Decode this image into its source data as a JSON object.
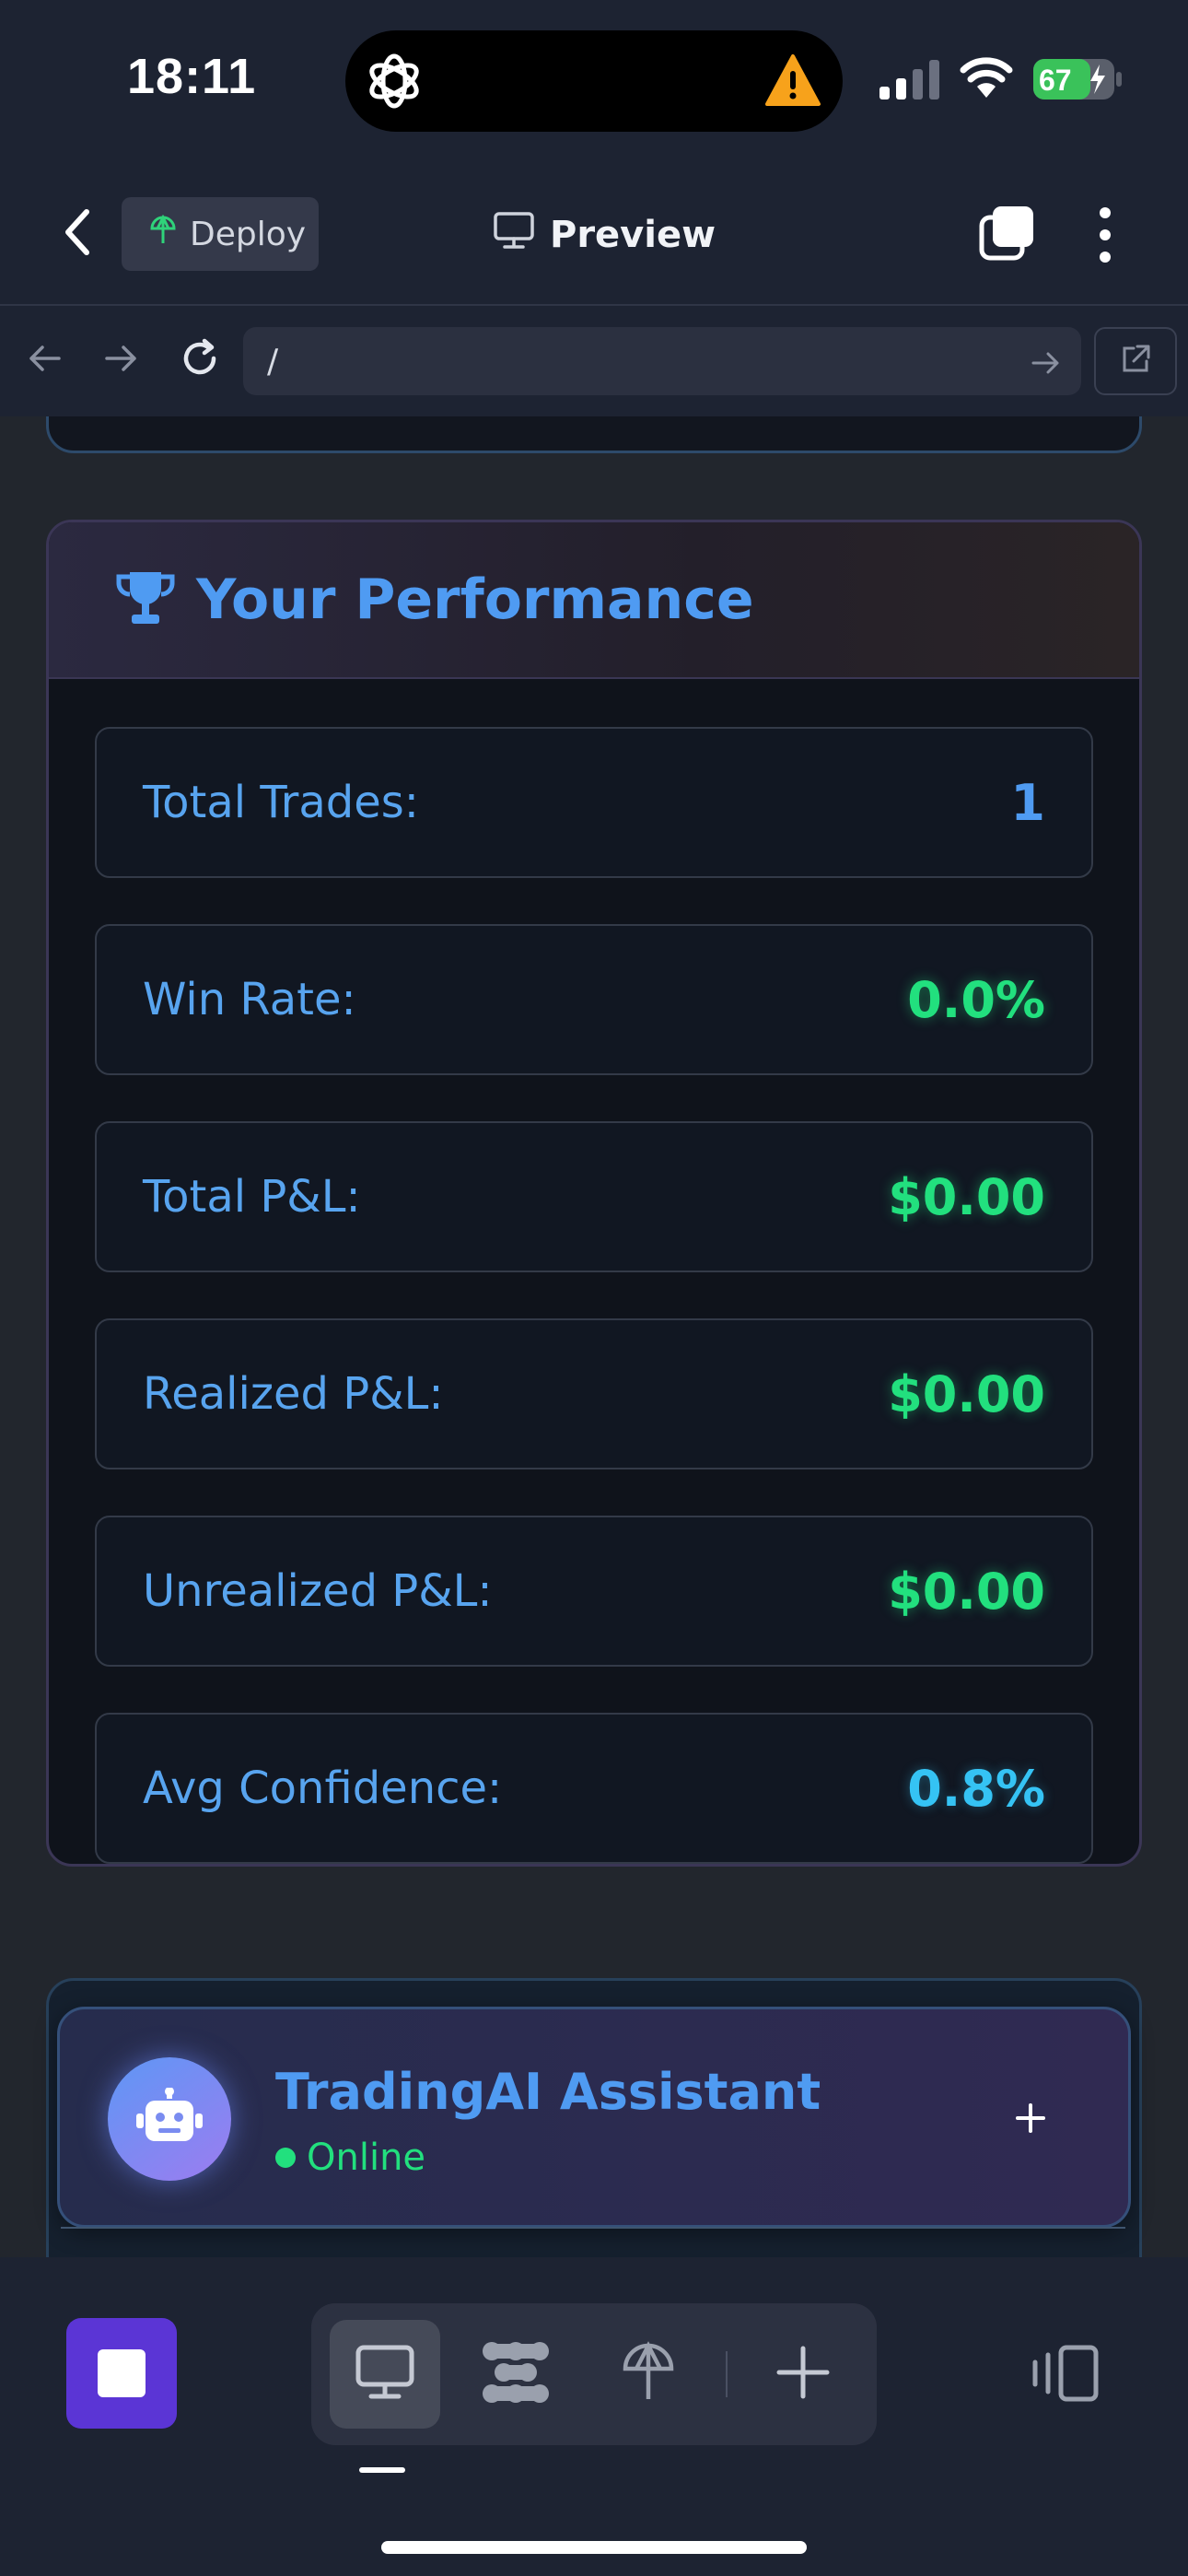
{
  "status_bar": {
    "time": "18:11",
    "battery": "67",
    "icons": [
      "openai-logo-icon",
      "warning-icon",
      "signal-icon",
      "wifi-icon",
      "battery-charging-icon"
    ]
  },
  "app_bar": {
    "deploy_label": "Deploy",
    "preview_label": "Preview"
  },
  "url_bar": {
    "url": "/"
  },
  "performance": {
    "title": "Your Performance",
    "stats": [
      {
        "label": "Total Trades:",
        "value": "1"
      },
      {
        "label": "Win Rate:",
        "value": "0.0%"
      },
      {
        "label": "Total P&L:",
        "value": "$0.00"
      },
      {
        "label": "Realized P&L:",
        "value": "$0.00"
      },
      {
        "label": "Unrealized P&L:",
        "value": "$0.00"
      },
      {
        "label": "Avg Confidence:",
        "value": "0.8%"
      }
    ]
  },
  "assistant": {
    "name": "TradingAI Assistant",
    "status": "Online"
  },
  "colors": {
    "accent_blue": "#4f9bf2",
    "positive_green": "#22e07e",
    "cyan": "#35c3f4",
    "stop_purple": "#5b35d5"
  }
}
